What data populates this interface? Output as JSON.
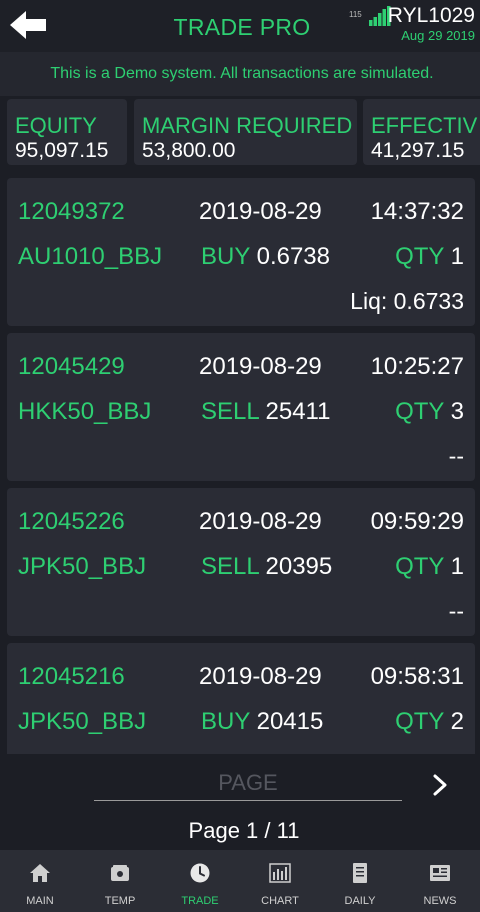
{
  "header": {
    "title": "TRADE PRO",
    "signal_number": "115",
    "account": "RYL1029",
    "date": "Aug 29 2019",
    "accent_color": "#2ecf72"
  },
  "banner": {
    "text": "This is a Demo system. All transactions are simulated."
  },
  "summary": [
    {
      "label": "EQUITY",
      "value": "95,097.15"
    },
    {
      "label": "MARGIN REQUIRED",
      "value": "53,800.00"
    },
    {
      "label": "EFFECTIV",
      "value": "41,297.15"
    }
  ],
  "orders": [
    {
      "id": "12049372",
      "date": "2019-08-29",
      "time": "14:37:32",
      "symbol": "AU1010_BBJ",
      "side": "BUY",
      "price": "0.6738",
      "qty_label": "QTY",
      "qty": "1",
      "liq": "Liq: 0.6733"
    },
    {
      "id": "12045429",
      "date": "2019-08-29",
      "time": "10:25:27",
      "symbol": "HKK50_BBJ",
      "side": "SELL",
      "price": "25411",
      "qty_label": "QTY",
      "qty": "3",
      "liq": "--"
    },
    {
      "id": "12045226",
      "date": "2019-08-29",
      "time": "09:59:29",
      "symbol": "JPK50_BBJ",
      "side": "SELL",
      "price": "20395",
      "qty_label": "QTY",
      "qty": "1",
      "liq": "--"
    },
    {
      "id": "12045216",
      "date": "2019-08-29",
      "time": "09:58:31",
      "symbol": "JPK50_BBJ",
      "side": "BUY",
      "price": "20415",
      "qty_label": "QTY",
      "qty": "2",
      "liq": ""
    }
  ],
  "pager": {
    "placeholder": "PAGE",
    "info": "Page 1 / 11"
  },
  "nav": [
    {
      "label": "MAIN",
      "icon": "home-icon"
    },
    {
      "label": "TEMP",
      "icon": "wallet-icon"
    },
    {
      "label": "TRADE",
      "icon": "clock-icon",
      "active": true
    },
    {
      "label": "CHART",
      "icon": "chart-icon"
    },
    {
      "label": "DAILY",
      "icon": "document-icon"
    },
    {
      "label": "NEWS",
      "icon": "news-icon"
    }
  ]
}
